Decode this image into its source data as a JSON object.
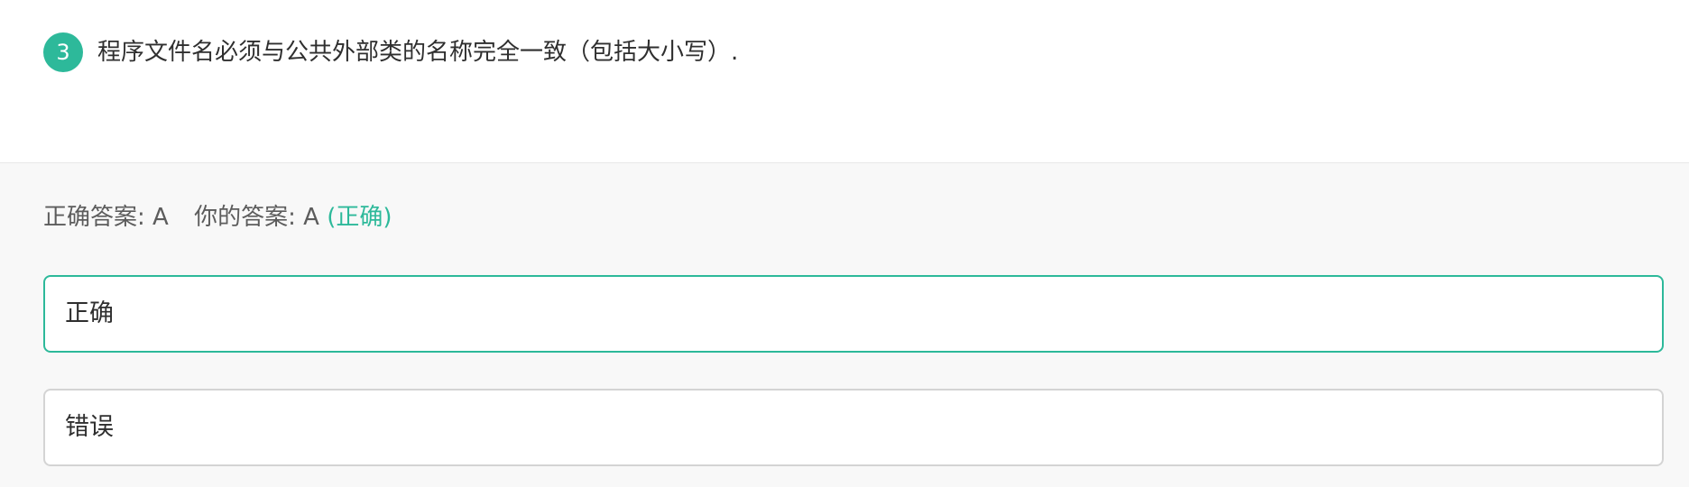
{
  "question": {
    "number": "3",
    "text": "程序文件名必须与公共外部类的名称完全一致（包括大小写）."
  },
  "result": {
    "correct_label": "正确答案:",
    "correct_value": "A",
    "yours_label": "你的答案:",
    "yours_value": "A",
    "status": "(正确)"
  },
  "options": [
    {
      "text": "正确",
      "selected": true
    },
    {
      "text": "错误",
      "selected": false
    }
  ],
  "colors": {
    "accent": "#2db99a",
    "border": "#d4d4d4",
    "panel_bg": "#f8f8f8"
  }
}
